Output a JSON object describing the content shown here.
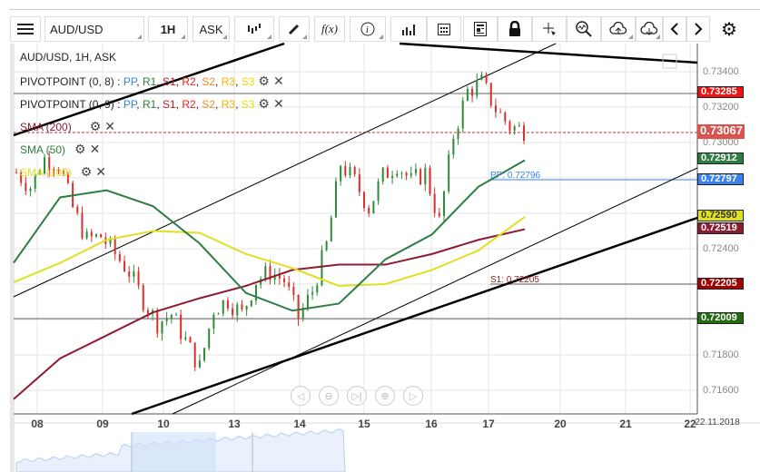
{
  "toolbar": {
    "symbol": "AUD/USD",
    "timeframe": "1H",
    "price_type": "ASK",
    "icons": [
      "menu-icon",
      "candlestick-icon",
      "pencil-icon",
      "function-icon",
      "info-icon",
      "bar-chart-icon",
      "calendar-icon",
      "news-icon",
      "lock-icon",
      "crosshair-icon",
      "zoom-chart-icon",
      "cloud-upload-icon",
      "cloud-download-icon",
      "chevron-left-icon",
      "chevron-right-icon",
      "gear-icon"
    ],
    "fx_label": "f(x)"
  },
  "legend": {
    "title": "AUD/USD, 1H, ASK",
    "pivot1": {
      "name": "PIVOTPOINT (0, 8)",
      "sep": " : "
    },
    "pivot2": {
      "name": "PIVOTPOINT (0, 9)",
      "sep": " : "
    },
    "pivot_parts": [
      {
        "label": "PP",
        "color": "#3a7fe0"
      },
      {
        "label": "R1",
        "color": "#2f7d32"
      },
      {
        "label": "S1",
        "color": "#b22222"
      },
      {
        "label": "R2",
        "color": "#e8251c"
      },
      {
        "label": "S2",
        "color": "#f08a1c"
      },
      {
        "label": "R3",
        "color": "#f5b400"
      },
      {
        "label": "S3",
        "color": "#e8e000"
      }
    ],
    "sma200": "SMA (200)",
    "sma50": "SMA (50)",
    "sma100": "SMA (100)",
    "gear": "⚙",
    "close": "✕"
  },
  "price_axis": {
    "ticks": [
      "0.73400",
      "0.73200",
      "0.73000",
      "0.72400",
      "0.71800",
      "0.71600"
    ],
    "badges": [
      {
        "value": "0.73285",
        "color": "#ee1111",
        "text": "#fff"
      },
      {
        "value": "0.73067",
        "color": "#d9534f",
        "text": "#fff"
      },
      {
        "value": "0.72912",
        "color": "#2e7d42",
        "text": "#fff"
      },
      {
        "value": "0.72797",
        "color": "#3b82f0",
        "text": "#fff"
      },
      {
        "value": "0.72590",
        "color": "#e0e020",
        "text": "#333"
      },
      {
        "value": "0.72519",
        "color": "#8b1c32",
        "text": "#fff"
      },
      {
        "value": "0.72205",
        "color": "#a50000",
        "text": "#fff"
      },
      {
        "value": "0.72009",
        "color": "#236b10",
        "text": "#fff"
      }
    ]
  },
  "annotations": {
    "pp": "PP: 0.72796",
    "s1": "S1: 0.72205"
  },
  "date_axis": {
    "labels": [
      "08",
      "09",
      "10",
      "13",
      "14",
      "15",
      "16",
      "17",
      "20",
      "21",
      "22"
    ],
    "end_date": "22.11.2018"
  },
  "nav_buttons": [
    "◁",
    "⊖",
    "▷|",
    "⊕",
    "▷"
  ],
  "series": {
    "closes": [
      0.7283,
      0.7275,
      0.7291,
      0.7288,
      0.7263,
      0.7245,
      0.7247,
      0.7237,
      0.7227,
      0.7211,
      0.7198,
      0.7203,
      0.7188,
      0.7173,
      0.7206,
      0.7211,
      0.7203,
      0.7222,
      0.7227,
      0.7222,
      0.7201,
      0.7216,
      0.7242,
      0.7288,
      0.7278,
      0.7263,
      0.7281,
      0.7288,
      0.7278,
      0.7283,
      0.7255,
      0.7304,
      0.7329,
      0.7334,
      0.7319,
      0.7309,
      0.7307
    ],
    "sma50": [
      0.7232,
      0.7269,
      0.7273,
      0.7264,
      0.7243,
      0.7215,
      0.7205,
      0.7209,
      0.7234,
      0.7248,
      0.7275,
      0.729
    ],
    "sma100": [
      0.7221,
      0.7232,
      0.7245,
      0.725,
      0.7249,
      0.7237,
      0.7229,
      0.7219,
      0.722,
      0.7228,
      0.7239,
      0.7258
    ],
    "sma200": [
      0.7155,
      0.7178,
      0.7191,
      0.7204,
      0.7212,
      0.7219,
      0.7228,
      0.7231,
      0.7231,
      0.7237,
      0.7245,
      0.7251
    ]
  },
  "colors": {
    "up": "#2e8b3a",
    "down": "#d9302c",
    "sma50": "#2e7d42",
    "sma100": "#e0e020",
    "sma200": "#8b1c32"
  }
}
